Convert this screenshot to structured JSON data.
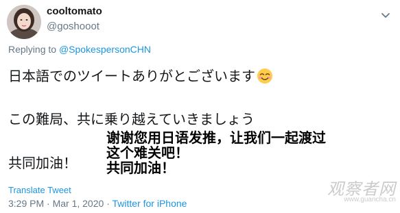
{
  "author": {
    "display_name": "cooltomato",
    "handle": "@goshooot"
  },
  "reply": {
    "prefix": "Replying to",
    "mention": "@SpokespersonCHN"
  },
  "tweet": {
    "lines": [
      "日本語でのツイートありがとございます",
      "この難局、共に乗り越えていきましょう",
      "共同加油！"
    ],
    "emoji": "smiling-face-with-smiling-eyes-icon"
  },
  "caption_overlay": {
    "lines": [
      "谢谢您用日语发推，让我们一起渡过",
      "这个难关吧！",
      "共同加油！"
    ]
  },
  "footer": {
    "translate_label": "Translate Tweet",
    "timestamp": "3:29 PM · Mar 1, 2020",
    "separator": "·",
    "source": "Twitter for iPhone"
  },
  "watermark": {
    "title": "观察者网",
    "url": "www.guancha.cn"
  },
  "colors": {
    "link": "#1b95e0",
    "muted": "#657786",
    "text": "#14171a"
  },
  "icons": {
    "more": "chevron-down-icon",
    "avatar": "avatar"
  }
}
